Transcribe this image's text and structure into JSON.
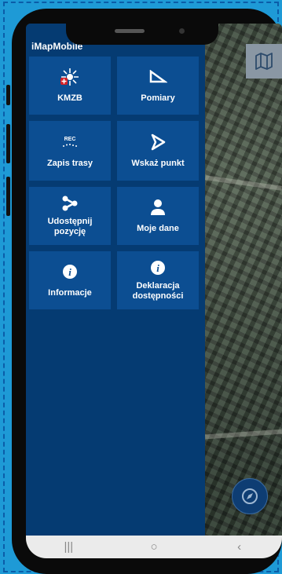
{
  "app": {
    "title": "iMapMobile"
  },
  "menu": {
    "tiles": [
      {
        "label": "KMZB",
        "icon": "kmzb-emblem-icon"
      },
      {
        "label": "Pomiary",
        "icon": "triangle-ruler-icon"
      },
      {
        "label": "Zapis trasy",
        "icon": "rec-track-icon",
        "icon_text": "REC"
      },
      {
        "label": "Wskaż punkt",
        "icon": "pointer-arrow-icon"
      },
      {
        "label": "Udostępnij\npozycję",
        "icon": "share-icon"
      },
      {
        "label": "Moje dane",
        "icon": "user-icon"
      },
      {
        "label": "Informacje",
        "icon": "info-icon"
      },
      {
        "label": "Deklaracja\ndostępności",
        "icon": "info-icon"
      }
    ]
  },
  "map": {
    "layers_icon": "map-icon",
    "compass_icon": "compass-icon"
  },
  "android_nav": {
    "recents": "|||",
    "home": "○",
    "back": "‹"
  },
  "colors": {
    "drawer": "#053b72",
    "tile": "#0c4e92",
    "background": "#1e9ad6"
  }
}
